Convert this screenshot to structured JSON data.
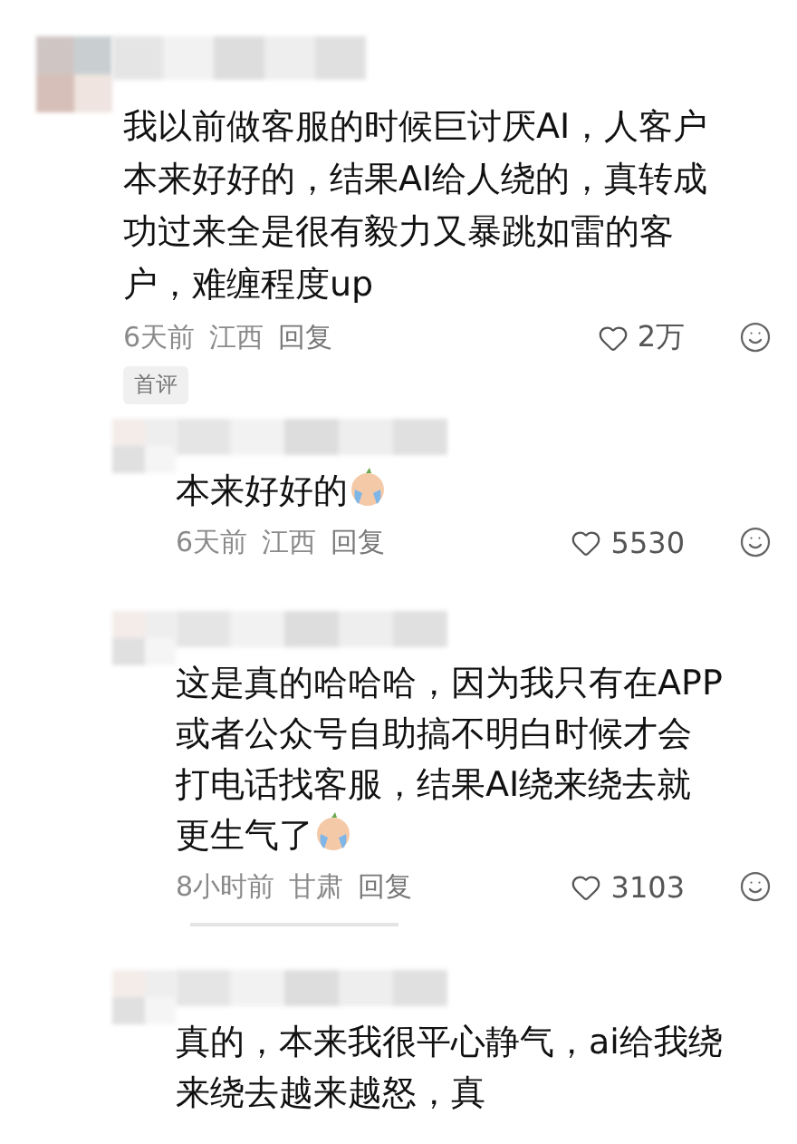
{
  "comments": [
    {
      "lines": [
        "我以前做客服的时候巨讨厌AI，人客户",
        "本来好好的，结果AI给人绕的，真转成",
        "功过来全是很有毅力又暴跳如雷的客",
        "户，难缠程度up"
      ],
      "emoji": false,
      "time": "6天前",
      "region": "江西",
      "reply": "回复",
      "likes": "2万",
      "badge": "首评",
      "replies": [
        {
          "lines": [
            "本来好好的"
          ],
          "emoji": true,
          "time": "6天前",
          "region": "江西",
          "reply": "回复",
          "likes": "5530"
        },
        {
          "lines": [
            "这是真的哈哈哈，因为我只有在APP",
            "或者公众号自助搞不明白时候才会",
            "打电话找客服，结果AI绕来绕去就",
            "更生气了"
          ],
          "emoji": true,
          "time": "8小时前",
          "region": "甘肃",
          "reply": "回复",
          "likes": "3103"
        },
        {
          "lines": [
            "真的，本来我很平心静气，ai给我绕",
            "来绕去越来越怒，真"
          ],
          "emoji": false
        }
      ]
    }
  ]
}
